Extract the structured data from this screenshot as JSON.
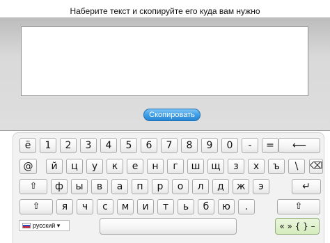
{
  "instruction": "Наберите текст и скопируйте его куда вам нужно",
  "editor": {
    "value": ""
  },
  "copy_button": {
    "label": "Скопировать"
  },
  "keyboard": {
    "row1": [
      "ё",
      "1",
      "2",
      "3",
      "4",
      "5",
      "6",
      "7",
      "8",
      "9",
      "0",
      "-",
      "="
    ],
    "backspace": "⟵",
    "row2_lead": "@",
    "row2": [
      "й",
      "ц",
      "у",
      "к",
      "е",
      "н",
      "г",
      "ш",
      "щ",
      "з",
      "х",
      "ъ",
      "\\"
    ],
    "row2_tail": "⌫",
    "row3_lead": "⇧",
    "row3": [
      "ф",
      "ы",
      "в",
      "а",
      "п",
      "р",
      "о",
      "л",
      "д",
      "ж",
      "э"
    ],
    "enter": "↵",
    "row4_lead": "⇧",
    "row4": [
      "я",
      "ч",
      "с",
      "м",
      "и",
      "т",
      "ь",
      "б",
      "ю",
      "."
    ],
    "row4_tail": "⇧"
  },
  "language": {
    "selected": "русский ▾",
    "flag": "russia-flag"
  },
  "symbols_key": {
    "label": "« » { } –"
  },
  "colors": {
    "accent_button": "#3f9fe6",
    "panel": "#d9d9d9",
    "symbols_key": "#d5ecbd"
  }
}
